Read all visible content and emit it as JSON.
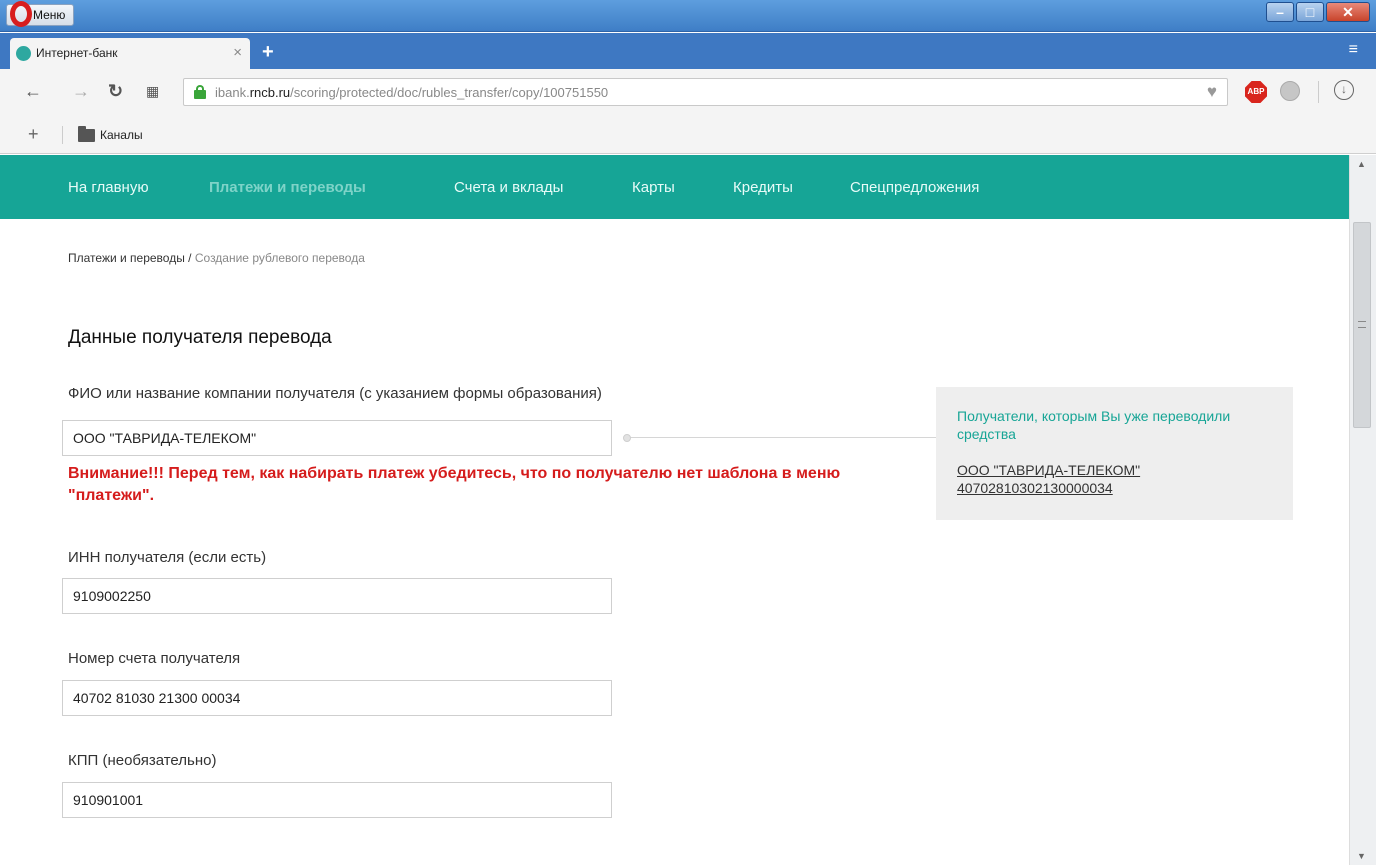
{
  "browser": {
    "menu_label": "Меню",
    "tab_title": "Интернет-банк",
    "url_prefix": "ibank.",
    "url_domain": "rncb.ru",
    "url_path": "/scoring/protected/doc/rubles_transfer/copy/100751550",
    "adblock_label": "ABP",
    "bookmark_folder": "Каналы"
  },
  "site_nav": {
    "items": [
      {
        "label": "На главную"
      },
      {
        "label": "Платежи и переводы",
        "active": true
      },
      {
        "label": "Счета и вклады"
      },
      {
        "label": "Карты"
      },
      {
        "label": "Кредиты"
      },
      {
        "label": "Спецпредложения"
      }
    ]
  },
  "breadcrumb": {
    "parent": "Платежи и переводы",
    "separator": " / ",
    "current": "Создание рублевого перевода"
  },
  "form": {
    "title": "Данные получателя перевода",
    "recipient_name_label": "ФИО или название компании получателя (с указанием формы образования)",
    "recipient_name_value": "ООО \"ТАВРИДА-ТЕЛЕКОМ\"",
    "warning": "Внимание!!! Перед тем, как набирать платеж убедитесь, что по получателю нет шаблона в меню \"платежи\".",
    "inn_label": "ИНН получателя (если есть)",
    "inn_value": "9109002250",
    "account_label": "Номер счета получателя",
    "account_value": "40702 81030 21300 00034",
    "kpp_label": "КПП (необязательно)",
    "kpp_value": "910901001"
  },
  "recent_recipients": {
    "title": "Получатели, которым Вы уже переводили средства",
    "items": [
      {
        "name": "ООО \"ТАВРИДА-ТЕЛЕКОМ\"",
        "account": "40702810302130000034"
      }
    ]
  },
  "colors": {
    "nav_bg": "#16a596",
    "accent": "#17a596",
    "warning": "#d51c1c"
  }
}
